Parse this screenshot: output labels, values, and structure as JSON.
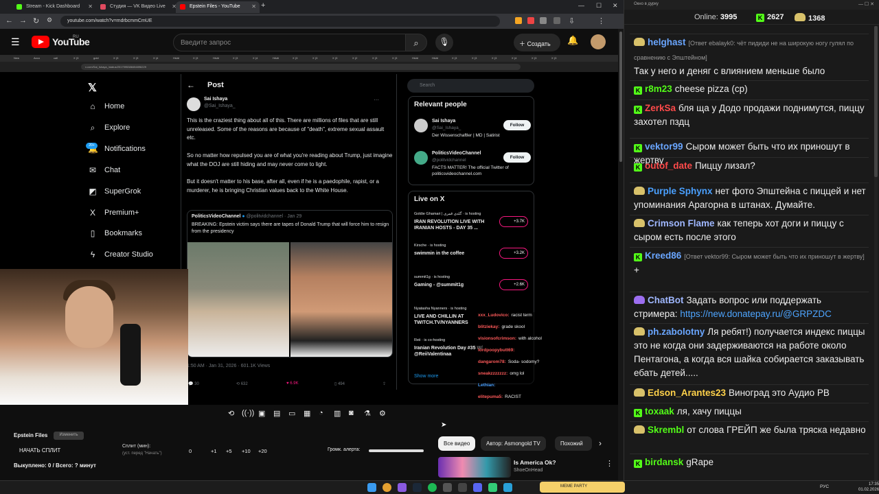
{
  "browser": {
    "tabs": [
      {
        "title": "Stream - Kick Dashboard",
        "color": "#53fc18"
      },
      {
        "title": "Студия — VK Видео Live",
        "color": "#e04a5f"
      },
      {
        "title": "Epstein Files - YouTube",
        "color": "#ff0000"
      }
    ],
    "url": "youtube.com/watch?v=mdrbcmmCmUE",
    "new_tab_icon": "plus-icon"
  },
  "youtube": {
    "logo_word": "YouTube",
    "logo_region": "RU",
    "search_placeholder": "Введите запрос",
    "create_label": "Создать"
  },
  "video_screen": {
    "mini_tabs": [
      "New",
      "Ассо",
      "call",
      "X (3",
      "gold",
      "X (3",
      "X (3",
      "X (4",
      "HAAI",
      "X (3",
      "HAAI",
      "X (3",
      "X (4",
      "HAAI",
      "X (3",
      "X (3",
      "X (3",
      "X (2",
      "X (3",
      "X (3",
      "HAAI",
      "HAAI",
      "X (3",
      "X (3",
      "X (3",
      "X (4",
      "X (3",
      "X (3"
    ],
    "mini_url": "x.com/Sai_Ishaya_/status/2017995388454896229",
    "x_nav": [
      {
        "icon": "home-icon",
        "glyph": "⌂",
        "label": "Home"
      },
      {
        "icon": "search-icon",
        "glyph": "⌕",
        "label": "Explore"
      },
      {
        "icon": "bell-icon",
        "glyph": "🔔",
        "label": "Notifications"
      },
      {
        "icon": "mail-icon",
        "glyph": "✉",
        "label": "Chat"
      },
      {
        "icon": "grok-icon",
        "glyph": "◩",
        "label": "SuperGrok"
      },
      {
        "icon": "x-icon",
        "glyph": "X",
        "label": "Premium+"
      },
      {
        "icon": "bookmark-icon",
        "glyph": "▯",
        "label": "Bookmarks"
      },
      {
        "icon": "lightning-icon",
        "glyph": "ϟ",
        "label": "Creator Studio"
      }
    ],
    "notif_badge": "20+",
    "post": {
      "header": "Post",
      "author_name": "Sai Ishaya",
      "author_handle": "@Sai_Ishaya_",
      "para1": "This is the craziest thing about all of this. There are millions of files that are still unreleased. Some of the reasons are because of \"death\", extreme sexual assault etc.",
      "para2": "So no matter how repulsed you are of what you're reading about Trump, just imagine what the DOJ are still hiding and may never come to light.",
      "para3": "But it doesn't matter to his base, after all, even if he is a paedophile, rapist, or a murderer, he is bringing Christian values back to the White House.",
      "quote_author": "PoliticsVideoChannel",
      "quote_handle": "@politvidchannel · Jan 29",
      "quote_text": "BREAKING: Epstein victim says there are tapes of Donald Trump that will force him to resign from the presidency",
      "date_line": "1:50 AM · Jan 31, 2026 · 601.1K Views",
      "replies": "30",
      "reposts": "632",
      "likes": "6.9K",
      "bookmarks": "494"
    },
    "search_placeholder": "Search",
    "relevant_title": "Relevant people",
    "relevant": [
      {
        "name": "Sai Ishaya",
        "handle": "@Sai_Ishaya_",
        "bio": "Der Wissenschaftler | MD | Satirist",
        "button": "Follow"
      },
      {
        "name": "PoliticsVideoChannel",
        "handle": "@politvidchannel",
        "bio": "FACTS MATTER! The official Twitter of politicsvideochannel.com",
        "button": "Follow"
      }
    ],
    "live_title": "Live on X",
    "live": [
      {
        "who": "Goldie Ghamari | گلدی قمری · is hosting",
        "title": "IRAN REVOLUTION LIVE WITH IRANIAN HOSTS - DAY 35 ...",
        "count": "+3.7K"
      },
      {
        "who": "Kirsche · is hosting",
        "title": "swimmin in the coffee",
        "count": "+3.2K"
      },
      {
        "who": "summit1g · is hosting",
        "title": "Gaming - @summit1g",
        "count": "+2.6K"
      },
      {
        "who": "Nyatasha Nyanners · is hosting",
        "title": "LIVE AND CHILLIN AT TWITCH.TV/NYANNERS",
        "count": ""
      },
      {
        "who": "Reii · is co-hosting",
        "title": "Iranian Revolution Day #35 W/ @ReiiValentinaa",
        "count": ""
      }
    ],
    "show_more": "Show more",
    "twitch_chat": [
      {
        "user": "xxx_Ludovico:",
        "text": "racist term",
        "color": "#ff5a5a"
      },
      {
        "user": "blitziekay:",
        "text": "grade skool",
        "color": "#ff5a5a"
      },
      {
        "user": "visionsofcrimson:",
        "text": "with alcohol",
        "color": "#ff5a5a"
      },
      {
        "user": "lordpoopybutt69:",
        "text": "",
        "color": "#ff5a5a"
      },
      {
        "user": "dangarom78:",
        "text": "Soda- sodomy?",
        "color": "#ff5a5a"
      },
      {
        "user": "sneakzzzzzzz:",
        "text": "omg lol",
        "color": "#ff5a5a"
      },
      {
        "user": "Lethian:",
        "text": "",
        "color": "#4aa0ff"
      },
      {
        "user": "elitepuma5:",
        "text": "RACIST",
        "color": "#ff5a5a"
      }
    ]
  },
  "split_panel": {
    "title": "Epstein Files",
    "chip": "Изменить",
    "start": "НАЧАТЬ СПЛИТ",
    "split_label": "Сплит (мин):",
    "split_sub": "(уст. перед \"Начать\")",
    "steps": [
      "0",
      "+1",
      "+5",
      "+10",
      "+20"
    ],
    "volume": "Громк. алерта:",
    "bought": "Выкуплено: 0 / Всего: ? минут"
  },
  "chips": [
    "Все видео",
    "Автор: Asmongold TV",
    "Похожий"
  ],
  "recommendation": {
    "title": "Is America Ok?",
    "channel": "ShoeOnHead"
  },
  "taskbar": {
    "lang": "РУС",
    "time": "17:35",
    "date": "01.02.2026",
    "meme": "MEME PARTY"
  },
  "chat": {
    "window_title": "Окно в дурку",
    "online_label": "Online:",
    "online_count": "3995",
    "kick_count": "2627",
    "vk_count": "1368",
    "messages": [
      {
        "user": "helghast",
        "color": "#6aa6ff",
        "badge": "p",
        "reply": "[Ответ ebalayk0: чёт пидиди не на широкую ногу гулял по сравнению с Эпштейном]",
        "text": "Так у него и деняг с влиянием меньше было"
      },
      {
        "user": "r8m23",
        "color": "#53fc18",
        "badge": "k",
        "reply": "",
        "text": "cheese pizza (cp)"
      },
      {
        "user": "ZerkSa",
        "color": "#ff4a4a",
        "badge": "k",
        "reply": "",
        "text": "бля ща у Додо продажи поднимутся, пиццу захотел пздц"
      },
      {
        "user": "vektor99",
        "color": "#6aa6ff",
        "badge": "k",
        "reply": "",
        "text": "Сыром может быть что их приношут в жертву"
      },
      {
        "user": "outof_date",
        "color": "#ff4a4a",
        "badge": "k",
        "reply": "",
        "text": "Пиццу лизал?"
      },
      {
        "user": "Purple Sphynx",
        "color": "#4aa0ff",
        "badge": "p",
        "reply": "",
        "text": "нет фото Эпштейна с пиццей и нет упоминания Арагорна в штанах. Думайте."
      },
      {
        "user": "Crimson Flame",
        "color": "#9fb7ff",
        "badge": "p",
        "reply": "",
        "text": "как теперь хот доги и пиццу с сыром есть после этого"
      },
      {
        "user": "Kreed86",
        "color": "#6aa6ff",
        "badge": "k",
        "reply": "[Ответ vektor99: Сыром может быть что их приношут в жертву]",
        "text": "+"
      },
      {
        "user": "ChatBot",
        "color": "#9fb7ff",
        "badge": "b",
        "reply": "",
        "text": "Задать вопрос или поддержать стримера:",
        "link": "https://new.donatepay.ru/@GRPZDC"
      },
      {
        "user": "ph.zabolotny",
        "color": "#6aa6ff",
        "badge": "p",
        "reply": "",
        "text": "Ля ребят!) получается индекс пиццы это не когда они задерживаются на работе около Пентагона, а когда вся шайка собирается заказывать ебать детей....."
      },
      {
        "user": "Edson_Arantes23",
        "color": "#ffd24a",
        "badge": "p",
        "reply": "",
        "text": "Виноград это Аудио РВ"
      },
      {
        "user": "toxaak",
        "color": "#53fc18",
        "badge": "k",
        "reply": "",
        "text": "ля, хачу пиццы"
      },
      {
        "user": "Skrembl",
        "color": "#53fc18",
        "badge": "p",
        "reply": "",
        "text": "от слова ГРЕЙП же была тряска недавно"
      },
      {
        "user": "birdansk",
        "color": "#53fc18",
        "badge": "k",
        "reply": "",
        "text": "gRape"
      }
    ]
  },
  "colors": {
    "kick": "#53fc18",
    "yt_red": "#ff0000",
    "x_blue": "#1d9bf0",
    "like_pink": "#f91880"
  }
}
